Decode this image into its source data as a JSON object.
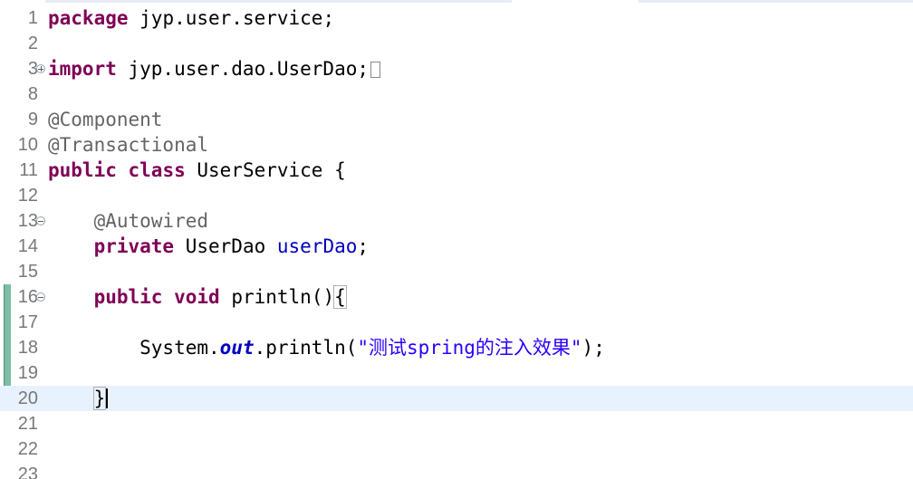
{
  "editor": {
    "language": "java",
    "current_line": 20,
    "colors": {
      "keyword": "#7f0055",
      "annotation": "#646464",
      "field": "#0000c0",
      "string": "#2a00ff",
      "line_number": "#787878",
      "current_line_bg": "#e8f2fe",
      "change_bar": "#7dbfa6"
    },
    "lines": [
      {
        "num": "1",
        "tokens": [
          {
            "t": "package",
            "c": "kw"
          },
          {
            "t": " jyp.user.service;"
          }
        ]
      },
      {
        "num": "2",
        "tokens": []
      },
      {
        "num": "3",
        "fold": "expand",
        "tokens": [
          {
            "t": "import",
            "c": "kw"
          },
          {
            "t": " jyp.user.dao.UserDao;"
          }
        ],
        "collapsed_marker": true
      },
      {
        "num": "8",
        "tokens": []
      },
      {
        "num": "9",
        "tokens": [
          {
            "t": "@Component",
            "c": "ann"
          }
        ]
      },
      {
        "num": "10",
        "tokens": [
          {
            "t": "@Transactional",
            "c": "ann"
          }
        ]
      },
      {
        "num": "11",
        "tokens": [
          {
            "t": "public",
            "c": "kw"
          },
          {
            "t": " "
          },
          {
            "t": "class",
            "c": "kw"
          },
          {
            "t": " UserService {"
          }
        ]
      },
      {
        "num": "12",
        "tokens": []
      },
      {
        "num": "13",
        "fold": "collapse",
        "tokens": [
          {
            "t": "    "
          },
          {
            "t": "@Autowired",
            "c": "ann"
          }
        ]
      },
      {
        "num": "14",
        "tokens": [
          {
            "t": "    "
          },
          {
            "t": "private",
            "c": "kw"
          },
          {
            "t": " UserDao "
          },
          {
            "t": "userDao",
            "c": "field"
          },
          {
            "t": ";"
          }
        ]
      },
      {
        "num": "15",
        "tokens": []
      },
      {
        "num": "16",
        "fold": "collapse",
        "tokens": [
          {
            "t": "    "
          },
          {
            "t": "public",
            "c": "kw"
          },
          {
            "t": " "
          },
          {
            "t": "void",
            "c": "kw"
          },
          {
            "t": " println()"
          },
          {
            "t": "{",
            "c": "bracket-match"
          }
        ]
      },
      {
        "num": "17",
        "tokens": []
      },
      {
        "num": "18",
        "tokens": [
          {
            "t": "        System."
          },
          {
            "t": "out",
            "c": "static-field"
          },
          {
            "t": ".println("
          },
          {
            "t": "\"测试spring的注入效果\"",
            "c": "str"
          },
          {
            "t": ");"
          }
        ]
      },
      {
        "num": "19",
        "tokens": []
      },
      {
        "num": "20",
        "tokens": [
          {
            "t": "    "
          },
          {
            "t": "}",
            "c": "bracket-match"
          }
        ],
        "caret": true
      },
      {
        "num": "21",
        "tokens": []
      },
      {
        "num": "22",
        "tokens": []
      },
      {
        "num": "23",
        "tokens": []
      }
    ]
  }
}
